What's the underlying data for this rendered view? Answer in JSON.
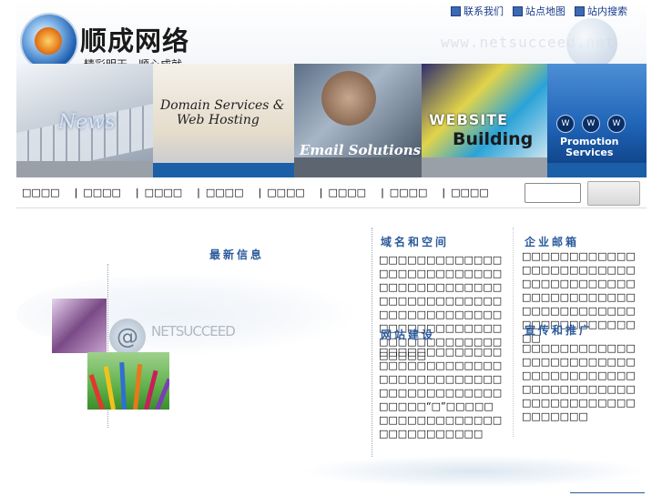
{
  "header": {
    "brand_name": "顺成网络",
    "slogan": "精彩明天，顺心成就",
    "domain_watermark": "www.netsucceed.net",
    "top_links": [
      {
        "label": "联系我们",
        "icon": "square-bullet-icon"
      },
      {
        "label": "站点地图",
        "icon": "square-bullet-icon"
      },
      {
        "label": "站内搜索",
        "icon": "square-bullet-icon"
      }
    ]
  },
  "banners": [
    {
      "label": "News"
    },
    {
      "label_line1": "Domain Services &",
      "label_line2": "Web Hosting"
    },
    {
      "label": "Email Solutions"
    },
    {
      "label_line1": "WEBSITE",
      "label_line2": "Building"
    },
    {
      "www": [
        "W",
        "W",
        "W"
      ],
      "label_line1": "Promotion",
      "label_line2": "Services"
    }
  ],
  "nav": {
    "items": [
      "□□□□",
      "□□□□",
      "□□□□",
      "□□□□",
      "□□□□",
      "□□□□",
      "□□□□",
      "□□□□"
    ],
    "separator": "|"
  },
  "search": {
    "value": "",
    "button_label": ""
  },
  "left": {
    "title": "最新信息",
    "watermark": "NETSUCCEED"
  },
  "sections": {
    "domain": {
      "title": "域名和空间",
      "body": "□□□□□□□□□□□□□□□□□□□□□□□□□□□□□□□□□□□□□□□□□□□□□□□□□□□□□□□□□□□□□□□□□□□□□□□□□□□□□□□□□□□□□□□□□□□□□□□□"
    },
    "email": {
      "title": "企业邮箱",
      "body": "□□□□□□□□□□□□□□□□□□□□□□□□□□□□□□□□□□□□□□□□□□□□□□□□□□□□□□□□□□□□□□□□□□□□□□□□□□"
    },
    "website": {
      "title": "网站建设",
      "body": "□□□□□□□□□□□□□□□□□□□□□□□□□□□□□□□□□□□□□□□□□□□□□□□□□□□□□□□□□“□”□□□□□□□□□□□□□□□□□□□□□□□□□□□□□"
    },
    "promotion": {
      "title": "宣传和推广",
      "body": "□□□□□□□□□□□□□□□□□□□□□□□□□□□□□□□□□□□□□□□□□□□□□□□□□□□□□□□□□□□□□□□□□□□"
    }
  },
  "colors": {
    "title_blue": "#2b5a9c",
    "link_blue": "#1a3c8c",
    "banner_bar_blue": "#1b5fa8"
  }
}
